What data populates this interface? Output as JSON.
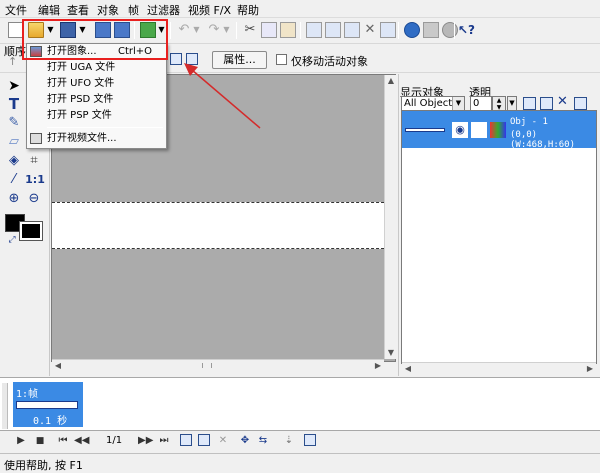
{
  "menubar": {
    "items": [
      "文件",
      "编辑",
      "查看",
      "对象",
      "帧",
      "过滤器",
      "视频 F/X",
      "帮助"
    ]
  },
  "toolbar": {
    "partial_label": "顺序",
    "properties_button": "属性...",
    "move_active_only_label": "仅移动活动对象"
  },
  "file_menu": {
    "items": [
      {
        "label": "打开图象...",
        "shortcut": "Ctrl+O"
      },
      {
        "label": "打开 UGA 文件",
        "shortcut": ""
      },
      {
        "label": "打开 UFO 文件",
        "shortcut": ""
      },
      {
        "label": "打开 PSD 文件",
        "shortcut": ""
      },
      {
        "label": "打开 PSP 文件",
        "shortcut": ""
      },
      {
        "label": "打开视频文件...",
        "shortcut": ""
      }
    ]
  },
  "tools": {
    "text_tool": "T",
    "actual_size": "1:1"
  },
  "right_panel": {
    "show_objects_label": "显示对象",
    "transparency_label": "透明",
    "show_objects_value": "All Objects",
    "transparency_value": "0",
    "object": {
      "name": "Obj - 1",
      "info": "(0,0)(W:468,H:60)"
    }
  },
  "timeline": {
    "frame_label": "1:帧",
    "frame_duration": "0.1 秒"
  },
  "playback": {
    "frame_counter": "1/1"
  },
  "status": {
    "text": "使用帮助, 按 F1"
  },
  "colors": {
    "selection_blue": "#3b8ae4",
    "highlight_red": "#e8201f",
    "arrow_red": "#d42b2b"
  }
}
